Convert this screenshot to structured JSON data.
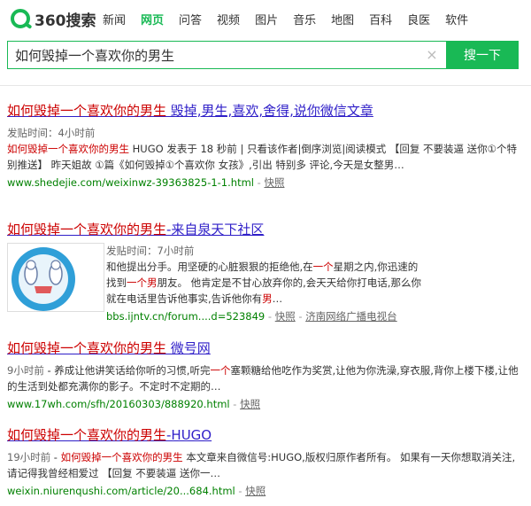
{
  "header": {
    "logo_num": "360",
    "logo_text": "搜索",
    "nav": [
      "新闻",
      "网页",
      "问答",
      "视频",
      "图片",
      "音乐",
      "地图",
      "百科",
      "良医",
      "软件"
    ],
    "active_nav": "网页"
  },
  "search": {
    "query": "如何毁掉一个喜欢你的男生",
    "button": "搜一下",
    "clear": "×"
  },
  "results": [
    {
      "title_hl": "如何毁掉一个喜欢你的男生",
      "title_rest": " 毁掉,男生,喜欢,舍得,说你微信文章",
      "meta": "发贴时间：4小时前",
      "snippet_hl": "如何毁掉一个喜欢你的男生",
      "snippet": " HUGO 发表于 18 秒前 | 只看该作者|倒序浏览|阅读模式 【回复 不要装逼 送你①个特别推送】 昨天姐故 ①篇《如何毁掉①个喜欢你 女孩》,引出 特别多 评论,今天是女整男…",
      "url": "www.shedejie.com/weixinwz-39363825-1-1.html",
      "sep": " - ",
      "kuaizhao": "快照"
    },
    {
      "title_hl": "如何毁掉一个喜欢你的男生",
      "title_rest": "-来自泉天下社区",
      "meta": "发贴时间：7小时前",
      "line1": "和他提出分手。用坚硬的心脏狠狠的拒绝他,在",
      "line1_hl": "一个",
      "line1_b": "星期之内,你迅速的",
      "line2": "找到",
      "line2_hl": "一个男",
      "line2_b": "朋友。 他肯定是不甘心放弃你的,会天天给你打电话,那么你",
      "line3": "就在电话里告诉他事实,告诉他你有",
      "line3_hl": "男",
      "line3_b": "…",
      "url": "bbs.ijntv.cn/forum....d=523849",
      "sep": " - ",
      "kuaizhao": "快照",
      "sep2": " - ",
      "source": "济南网络广播电视台"
    },
    {
      "title_hl": "如何毁掉一个喜欢你的男生",
      "title_rest": " 微号网",
      "meta_time": "9小时前",
      "snippet_a": " - 养成让他讲笑话给你听的习惯,听完",
      "snippet_hl": "一个",
      "snippet_b": "塞颗糖给他吃作为奖赏,让他为你洗澡,穿衣服,背你上楼下楼,让他的生活到处都充满你的影子。不定时不定期的…",
      "url": "www.17wh.com/sfh/20160303/888920.html",
      "sep": " - ",
      "kuaizhao": "快照"
    },
    {
      "title_hl": "如何毁掉一个喜欢你的男生",
      "title_rest": "-HUGO",
      "meta_time": "19小时前",
      "snippet_a": " - ",
      "snippet_hl": "如何毁掉一个喜欢你的男生",
      "snippet_b": " 本文章来自微信号:HUGO,版权归原作者所有。 如果有一天你想取消关注,请记得我曾经相爱过 【回复 不要装逼 送你一…",
      "url": "weixin.niurenqushi.com/article/20...684.html",
      "sep": " - ",
      "kuaizhao": "快照"
    }
  ],
  "colors": {
    "brand": "#19b955",
    "title_link": "#2f1fc8",
    "highlight": "#cc0000",
    "url": "#008000"
  }
}
